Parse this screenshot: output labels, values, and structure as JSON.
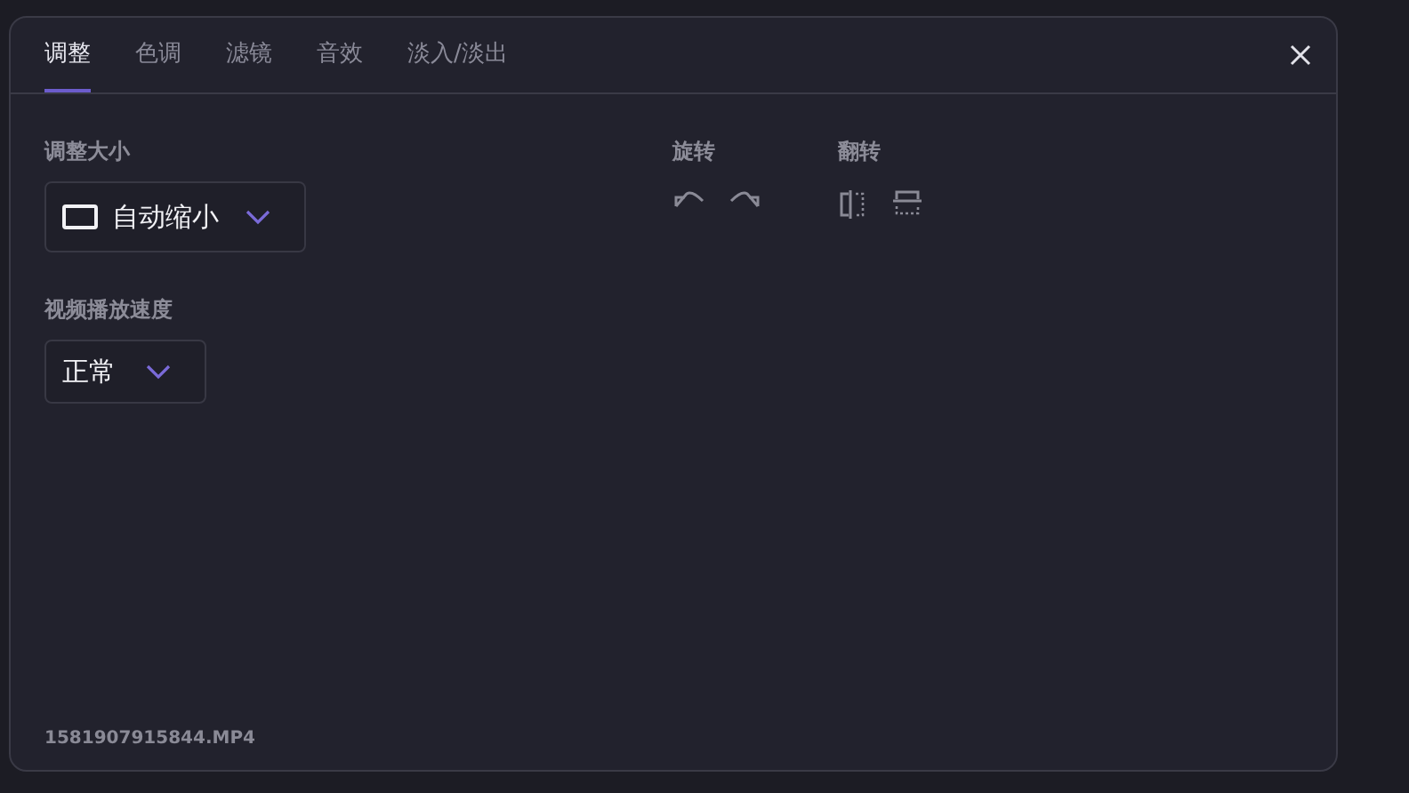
{
  "tabs": [
    {
      "label": "调整",
      "selected": true
    },
    {
      "label": "色调",
      "selected": false
    },
    {
      "label": "滤镜",
      "selected": false
    },
    {
      "label": "音效",
      "selected": false
    },
    {
      "label": "淡入/淡出",
      "selected": false
    }
  ],
  "resize": {
    "label": "调整大小",
    "value": "自动缩小"
  },
  "rotate": {
    "label": "旋转"
  },
  "flip": {
    "label": "翻转"
  },
  "speed": {
    "label": "视频播放速度",
    "value": "正常"
  },
  "file_name": "1581907915844.MP4"
}
